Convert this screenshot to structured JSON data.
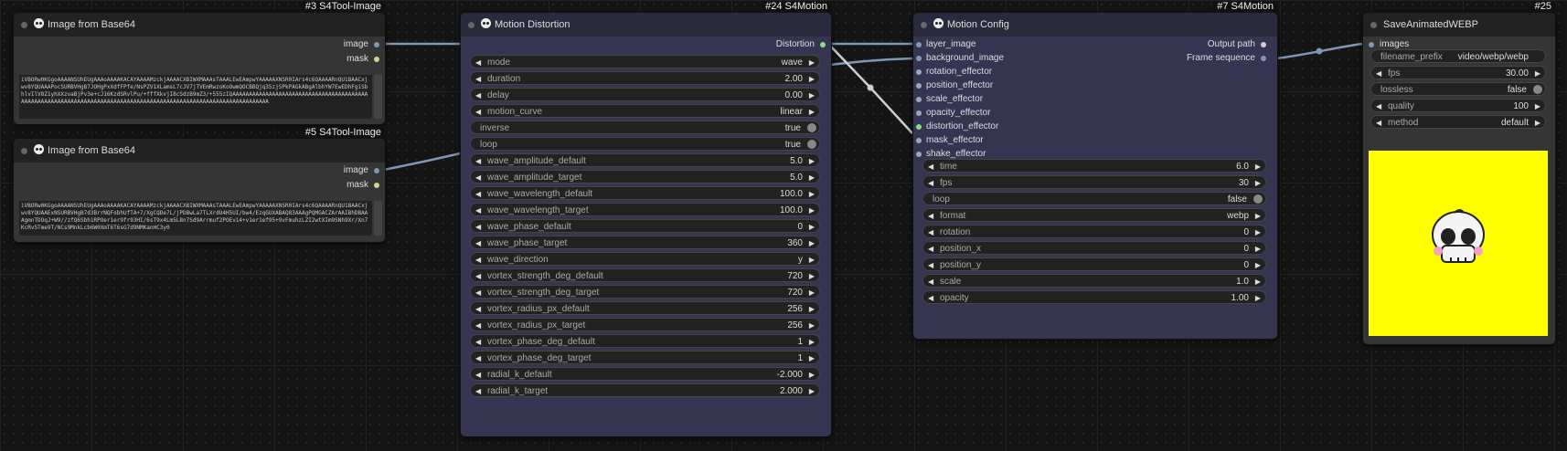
{
  "colors": {
    "image_link": "#7f98b5",
    "string_link": "#cfcfcf",
    "image_port": "#7f98b5",
    "mask_port": "#c6d68a",
    "bool_port": "#88dd88"
  },
  "node_image1": {
    "title": "Image from Base64",
    "badge": "#3 S4Tool-Image",
    "out_image": "image",
    "out_mask": "mask",
    "text": "iVBORw0KGgoAAAANSUhEUgAAAoAAAAKACAYAAAAMzckjAAAACXBIWXMAAAsTAAALEwEAmpwYAAAAAXNSR0IArs4c6QAAAARnQU1BAACxjwv8YQUAAAPocSURBVHgB7JOHgPxXdfFPfe/NsPZV1XLamsL7cJV7jTVEmRwzoKoOwmQOCBBQjq35zjSPkPAGkABgAlbhYW7EwEDhFgiSbhlvIlV8Z1yhXXzvaBjPv3e+cJ16KzdSRvlPu/+fffXkvjI8cSdzB9mZ3/+555zIQAAAAAAAAAAAAAAAAAAAAAAAAAAAAAAAAAAAAAAAAAAAAAAAAAAAAAAAAAAAAAAAAAAAAAAAAAAAAAAAAAAAAAAAAAAAAAAAAAAAAAAAAAAAAAAAAAAAA"
  },
  "node_image2": {
    "title": "Image from Base64",
    "badge": "#5 S4Tool-Image",
    "out_image": "image",
    "out_mask": "mask",
    "text": "iVBORw0KGgoAAAANSUhEUgAAAoAAAAKACAYAAAAMzckjAAAACXBIWXMAAAsTAAALEwEAmpwYAAAAAXNSR0IArs4c6QAAAARnQU1BAACxjwv8YQUAAExNSURBVHgB7d3BrrNQFobhUfTA+7/XgCQDe7L/jPDBwLa7TLXrdU4H5UI/bw4/EzqGUXABAQ83AAAgPQMGACZArAAIBhDBAAAgmnTDOqJ+W9//zfQ6Sbh1RPOer1er9fr93HI/6sT9x4Lm5L8n7Sd9Arrmuf2POEv14+v1er1ef95+9vFmuhzLZI2wtXIm9SNh9Xr/Xn7KcRv5Tme9T/NCs9MnkLcb6W0XmT6T6sG7d9NMKanHC3y0"
  },
  "node_motion": {
    "title": "Motion Distortion",
    "badge": "#24 S4Motion",
    "out": "Distortion",
    "widgets": [
      {
        "label": "mode",
        "value": "wave"
      },
      {
        "label": "duration",
        "value": "2.00"
      },
      {
        "label": "delay",
        "value": "0.00"
      },
      {
        "label": "motion_curve",
        "value": "linear"
      },
      {
        "label": "inverse",
        "value": "true"
      },
      {
        "label": "loop",
        "value": "true"
      },
      {
        "label": "wave_amplitude_default",
        "value": "5.0"
      },
      {
        "label": "wave_amplitude_target",
        "value": "5.0"
      },
      {
        "label": "wave_wavelength_default",
        "value": "100.0"
      },
      {
        "label": "wave_wavelength_target",
        "value": "100.0"
      },
      {
        "label": "wave_phase_default",
        "value": "0"
      },
      {
        "label": "wave_phase_target",
        "value": "360"
      },
      {
        "label": "wave_direction",
        "value": "y"
      },
      {
        "label": "vortex_strength_deg_default",
        "value": "720"
      },
      {
        "label": "vortex_strength_deg_target",
        "value": "720"
      },
      {
        "label": "vortex_radius_px_default",
        "value": "256"
      },
      {
        "label": "vortex_radius_px_target",
        "value": "256"
      },
      {
        "label": "vortex_phase_deg_default",
        "value": "1"
      },
      {
        "label": "vortex_phase_deg_target",
        "value": "1"
      },
      {
        "label": "radial_k_default",
        "value": "-2.000"
      },
      {
        "label": "radial_k_target",
        "value": "2.000"
      }
    ]
  },
  "node_config": {
    "title": "Motion Config",
    "badge": "#7 S4Motion",
    "inputs": [
      "layer_image",
      "background_image",
      "rotation_effector",
      "position_effector",
      "scale_effector",
      "opacity_effector",
      "distortion_effector",
      "mask_effector",
      "shake_effector"
    ],
    "outputs": [
      "Output path",
      "Frame sequence"
    ],
    "widgets": [
      {
        "label": "time",
        "value": "6.0"
      },
      {
        "label": "fps",
        "value": "30"
      },
      {
        "label": "loop",
        "value": "false"
      },
      {
        "label": "format",
        "value": "webp"
      },
      {
        "label": "rotation",
        "value": "0"
      },
      {
        "label": "position_x",
        "value": "0"
      },
      {
        "label": "position_y",
        "value": "0"
      },
      {
        "label": "scale",
        "value": "1.0"
      },
      {
        "label": "opacity",
        "value": "1.00"
      }
    ]
  },
  "node_save": {
    "title": "SaveAnimatedWEBP",
    "badge": "#25",
    "in": "images",
    "widgets": [
      {
        "label": "filename_prefix",
        "value": "video/webp/webp"
      },
      {
        "label": "fps",
        "value": "30.00"
      },
      {
        "label": "lossless",
        "value": "false"
      },
      {
        "label": "quality",
        "value": "100"
      },
      {
        "label": "method",
        "value": "default"
      }
    ]
  }
}
